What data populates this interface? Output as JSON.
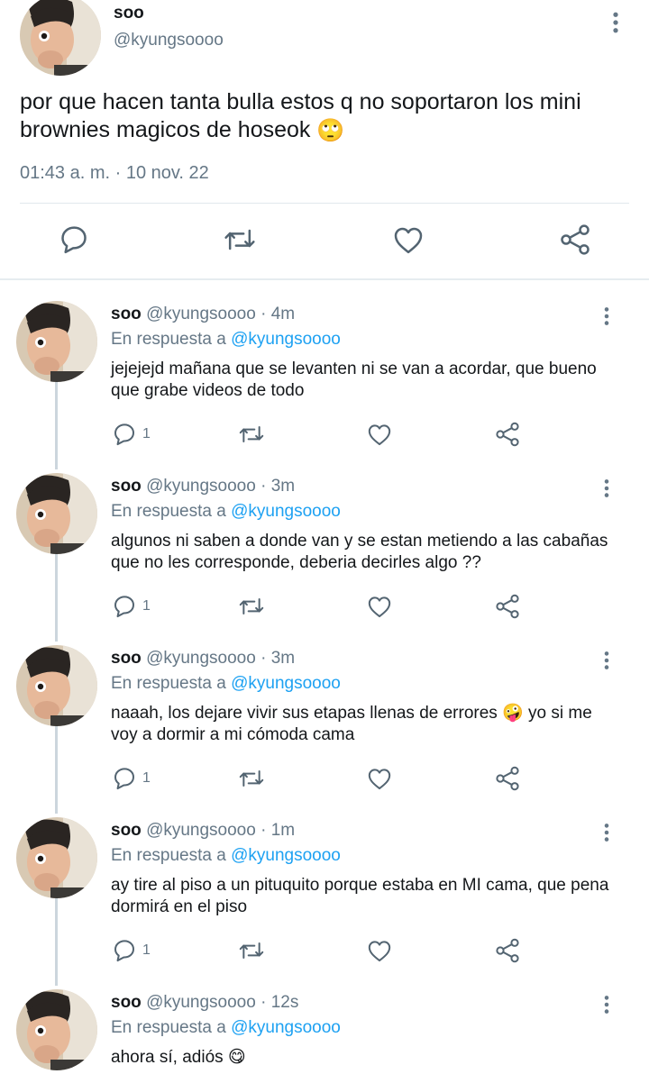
{
  "main_tweet": {
    "name": "soo",
    "handle": "@kyungsoooo",
    "text": "por que hacen tanta bulla estos q no soportaron los mini brownies magicos de hoseok",
    "emoji": "🙄",
    "timestamp": "01:43 a. m. · 10 nov. 22",
    "icons": [
      "reply-icon",
      "retweet-icon",
      "like-icon",
      "share-icon",
      "more-icon"
    ]
  },
  "replies": [
    {
      "name": "soo",
      "handle": "@kyungsoooo · 4m",
      "in_reply_prefix": "En respuesta a",
      "in_reply_to": "@kyungsoooo",
      "text": "jejejejd mañana que se levanten ni se van a acordar, que bueno que grabe videos de todo",
      "reply_count": "1"
    },
    {
      "name": "soo",
      "handle": "@kyungsoooo · 3m",
      "in_reply_prefix": "En respuesta a",
      "in_reply_to": "@kyungsoooo",
      "text": "algunos ni saben a donde van y se estan metiendo a las cabañas que no les corresponde, deberia decirles algo ??",
      "reply_count": "1"
    },
    {
      "name": "soo",
      "handle": "@kyungsoooo · 3m",
      "in_reply_prefix": "En respuesta a",
      "in_reply_to": "@kyungsoooo",
      "text_before": "naaah, los dejare vivir sus etapas llenas de errores",
      "emoji": "🤪",
      "text_after": " yo si me voy a dormir a mi cómoda cama",
      "reply_count": "1"
    },
    {
      "name": "soo",
      "handle": "@kyungsoooo · 1m",
      "in_reply_prefix": "En respuesta a",
      "in_reply_to": "@kyungsoooo",
      "text": "ay tire al piso a un pituquito porque estaba en MI cama, que pena dormirá en el piso",
      "reply_count": "1"
    },
    {
      "name": "soo",
      "handle": "@kyungsoooo · 12s",
      "in_reply_prefix": "En respuesta a",
      "in_reply_to": "@kyungsoooo",
      "text": "ahora sí, adiós",
      "emoji": "😋"
    }
  ],
  "colors": {
    "text": "#14171a",
    "secondary": "#657786",
    "link": "#1da1f2",
    "icon": "#536471",
    "divider": "#e1e8ed"
  }
}
